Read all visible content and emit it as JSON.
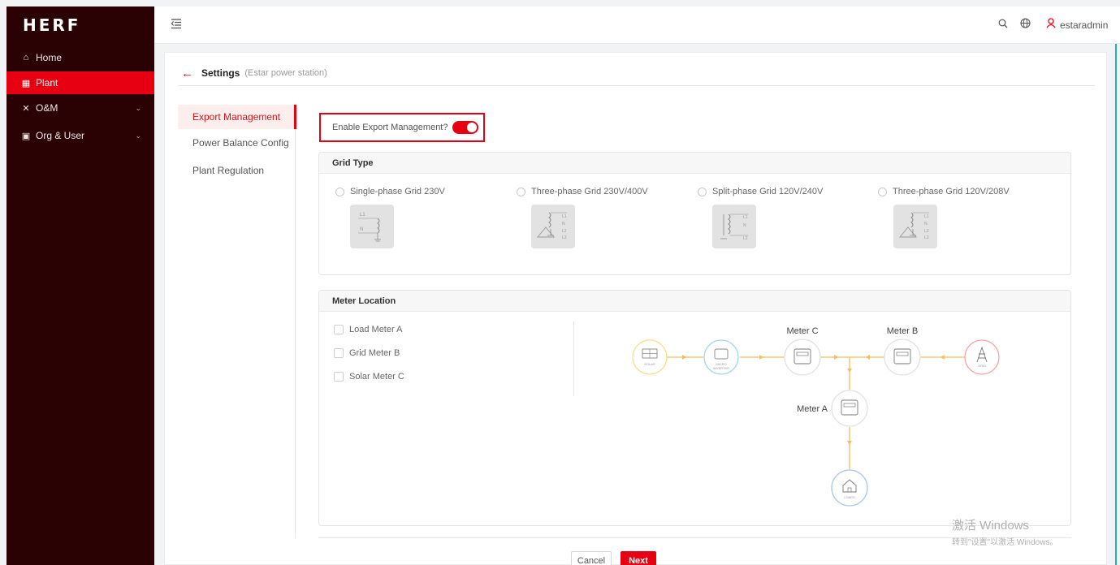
{
  "brand": {
    "logo": "HERF",
    "accent": "#e60012",
    "sidebar_bg": "#2a0203"
  },
  "sidebar": {
    "items": [
      {
        "label": "Home",
        "icon": "home-icon"
      },
      {
        "label": "Plant",
        "icon": "plant-icon",
        "active": true
      },
      {
        "label": "O&M",
        "icon": "tools-icon",
        "expandable": true
      },
      {
        "label": "Org & User",
        "icon": "org-icon",
        "expandable": true
      }
    ]
  },
  "header": {
    "username": "estaradmin"
  },
  "page": {
    "title": "Settings",
    "subtitle": "(Estar power station)"
  },
  "tabs": [
    {
      "label": "Export Management",
      "active": true
    },
    {
      "label": "Power Balance Config"
    },
    {
      "label": "Plant Regulation"
    }
  ],
  "export": {
    "enable_label": "Enable Export Management?",
    "enabled": true
  },
  "grid_type": {
    "title": "Grid Type",
    "options": [
      {
        "label": "Single-phase Grid 230V"
      },
      {
        "label": "Three-phase Grid 230V/400V"
      },
      {
        "label": "Split-phase Grid 120V/240V"
      },
      {
        "label": "Three-phase Grid 120V/208V"
      }
    ]
  },
  "meter_location": {
    "title": "Meter Location",
    "checkboxes": [
      {
        "label": "Load Meter A"
      },
      {
        "label": "Grid Meter B"
      },
      {
        "label": "Solar Meter C"
      }
    ],
    "diagram": {
      "meter_c": "Meter C",
      "meter_b": "Meter B",
      "meter_a": "Meter A",
      "solar": "SOLAR",
      "micro_1": "MICRO",
      "micro_2": "INVERTER",
      "grid": "GRID",
      "loads": "LOADS"
    }
  },
  "buttons": {
    "cancel": "Cancel",
    "next": "Next"
  },
  "watermark": {
    "line1": "激活 Windows",
    "line2": "转到\"设置\"以激活 Windows。"
  }
}
